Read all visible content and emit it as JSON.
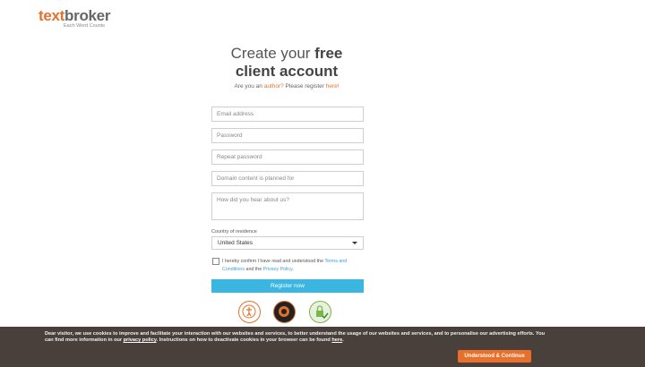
{
  "logo": {
    "part1": "text",
    "part2": "broker",
    "tagline": "Each Word Counts"
  },
  "heading": {
    "line1_prefix": "Create your ",
    "line1_bold": "free",
    "line2": "client account"
  },
  "subtitle": {
    "prefix": "Are you an ",
    "author_link": "author?",
    "middle": " Please register ",
    "here_link": "here!"
  },
  "form": {
    "email_placeholder": "Email address",
    "password_placeholder": "Password",
    "repeat_password_placeholder": "Repeat password",
    "domain_placeholder": "Domain content is planned for",
    "hear_placeholder": "How did you hear about us?",
    "country_label": "Country of residence",
    "country_value": "United States",
    "consent_prefix": "I hereby confirm I have read and understood the ",
    "terms_link": "Terms and Conditions",
    "consent_middle": " and the ",
    "privacy_link": "Privacy Policy",
    "consent_suffix": ".",
    "register_label": "Register now"
  },
  "badges": [
    "seal-badge-icon",
    "award-badge-icon",
    "ssl-secure-badge-icon"
  ],
  "cookie": {
    "text_part1": "Dear visitor, we use cookies to improve and facilitate your interaction with our websites and services, to better understand the usage of our websites and services, and to personalise our advertising efforts. You can find more information in our ",
    "privacy_link": "privacy policy",
    "text_part2": ". Instructions on how to deactivate cookies in your browser can be found ",
    "here_link": "here",
    "text_part3": ".",
    "button_label": "Understood & Continue"
  },
  "colors": {
    "accent": "#e5702a",
    "register_button": "#3bb6e1",
    "cookie_bar": "#4a403b"
  }
}
